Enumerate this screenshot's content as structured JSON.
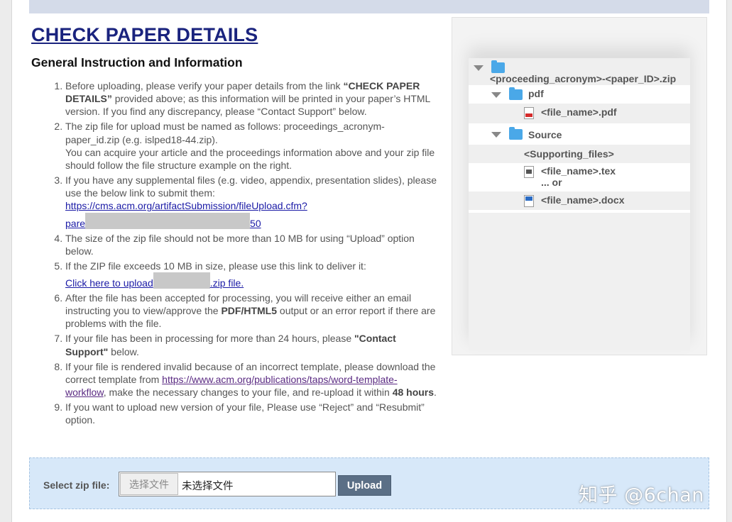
{
  "page": {
    "title": "CHECK PAPER DETAILS",
    "section_heading": "General Instruction and Information"
  },
  "instructions": {
    "i1_a": "Before uploading, please verify your paper details from the link ",
    "i1_b": "“CHECK PAPER DETAILS”",
    "i1_c": " provided above; as this information will be printed in your paper’s HTML version. If you find any discrepancy, please “Contact Support” below.",
    "i2_a": "The zip file for upload must be named as follows: proceedings_acronym-paper_id.zip (e.g. islped18-44.zip).",
    "i2_b": "You can acquire your article and the proceedings information above and your zip file should follow the file structure example on the right.",
    "i3_a": "If you have any supplemental files (e.g. video, appendix, presentation slides), please use the below link to submit them:",
    "i3_link1": "https://cms.acm.org/artifactSubmission/fileUpload.cfm?",
    "i3_link2a": "pare",
    "i3_link2b": "50",
    "i4": "The size of the zip file should not be more than 10 MB for using “Upload” option below.",
    "i5_a": "If the ZIP file exceeds 10 MB in size, please use this link to deliver it:",
    "i5_link_a": "Click here to upload",
    "i5_link_b": ".zip file.",
    "i6_a": "After the file has been accepted for processing, you will receive either an email instructing you to view/approve the ",
    "i6_b": "PDF/HTML5",
    "i6_c": " output or an error report if there are problems with the file.",
    "i7_a": "If your file has been in processing for more than 24 hours, please ",
    "i7_b": "\"Contact Support\"",
    "i7_c": " below.",
    "i8_a": "If your file is rendered invalid because of an incorrect template, please download the correct template from ",
    "i8_link": "https://www.acm.org/publications/taps/word-template-workflow",
    "i8_b": ", make the necessary changes to your file, and re-upload it within ",
    "i8_c": "48 hours",
    "i8_d": ".",
    "i9": "If you want to upload new version of your file, Please use “Reject” and “Resubmit” option."
  },
  "tree": {
    "root": "<proceeding_acronym>-<paper_ID>.zip",
    "pdf_folder": "pdf",
    "pdf_file": "<file_name>.pdf",
    "source_folder": "Source",
    "supporting": "<Supporting_files>",
    "tex_file": "<file_name>.tex",
    "or": "... or",
    "docx_file": "<file_name>.docx"
  },
  "upload": {
    "label": "Select zip file:",
    "choose_button": "选择文件",
    "no_file": "未选择文件",
    "upload_button": "Upload"
  },
  "watermark": "知乎 @6chan",
  "colors": {
    "title": "#1a237e",
    "top_bar": "#d4dbe9",
    "upload_bar": "#d7e8f9",
    "upload_button": "#5b6f86",
    "folder": "#4aa8e8",
    "link": "#1a1aa6"
  }
}
